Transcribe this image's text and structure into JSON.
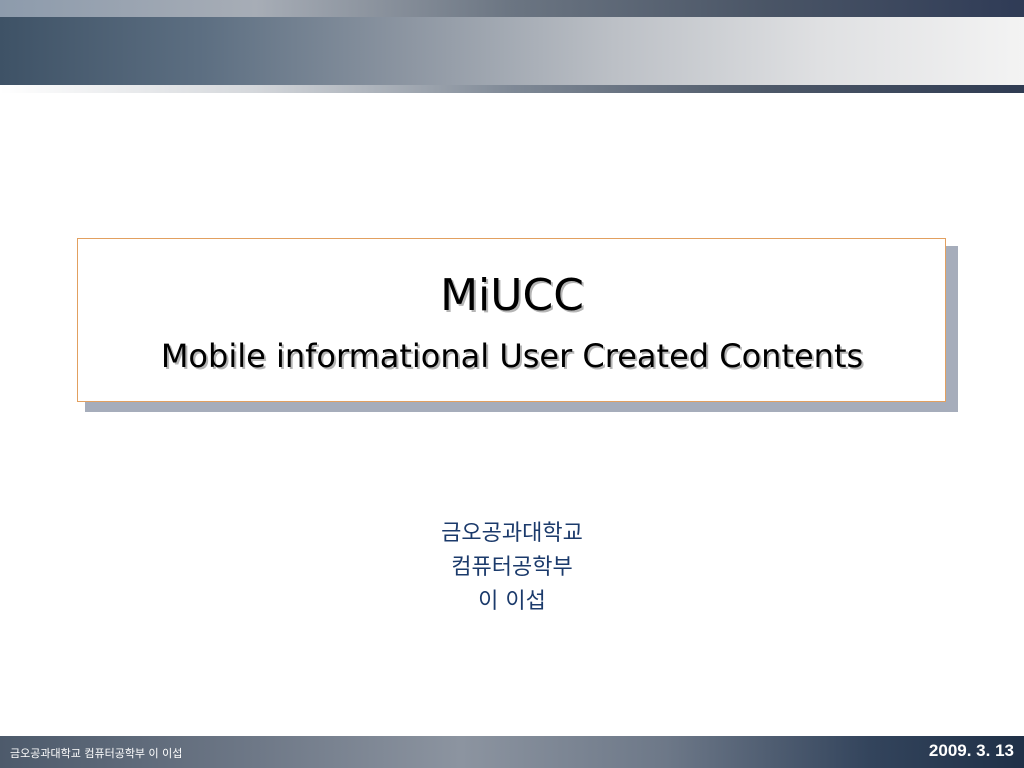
{
  "slide": {
    "title": "MiUCC",
    "subtitle": "Mobile informational User Created Contents",
    "author_lines": [
      "금오공과대학교",
      "컴퓨터공학부",
      "이 이섭"
    ]
  },
  "footer": {
    "left_text": "금오공과대학교 컴퓨터공학부 이 이섭",
    "date": "2009. 3. 13"
  },
  "colors": {
    "title_box_border": "#e2a060",
    "title_box_shadow": "#a6adbb",
    "author_text": "#1b3a6b",
    "footer_text": "#ffffff"
  }
}
